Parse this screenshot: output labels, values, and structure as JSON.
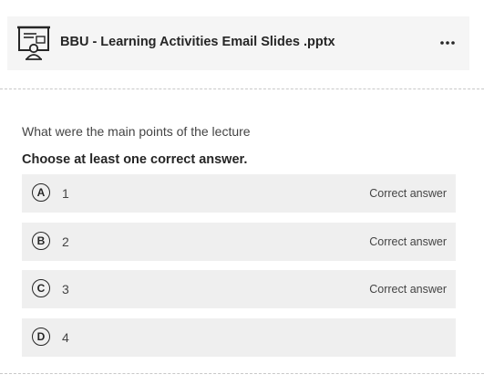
{
  "attachment": {
    "file_name": "BBU - Learning Activities Email Slides .pptx",
    "icon": "presentation-icon",
    "more_icon": "more-options-icon"
  },
  "question": {
    "text": "What were the main points of the lecture",
    "instructions": "Choose at least one correct answer."
  },
  "answers": [
    {
      "letter": "A",
      "value": "1",
      "status": "Correct answer"
    },
    {
      "letter": "B",
      "value": "2",
      "status": "Correct answer"
    },
    {
      "letter": "C",
      "value": "3",
      "status": "Correct answer"
    },
    {
      "letter": "D",
      "value": "4",
      "status": ""
    }
  ],
  "colors": {
    "card_background": "#f5f5f5",
    "answer_background": "#efefef",
    "text": "#262626",
    "divider": "#c8c8c8"
  }
}
